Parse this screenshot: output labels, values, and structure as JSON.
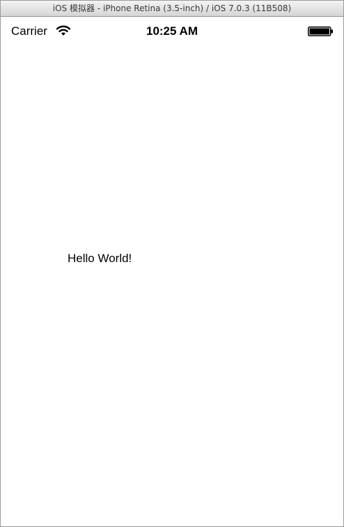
{
  "window": {
    "title": "iOS 模拟器 - iPhone Retina (3.5-inch) / iOS 7.0.3 (11B508)"
  },
  "status_bar": {
    "carrier": "Carrier",
    "time": "10:25 AM",
    "wifi_icon": "wifi-icon",
    "battery_icon": "battery-icon",
    "battery_level": 1.0
  },
  "content": {
    "label": "Hello World!"
  }
}
